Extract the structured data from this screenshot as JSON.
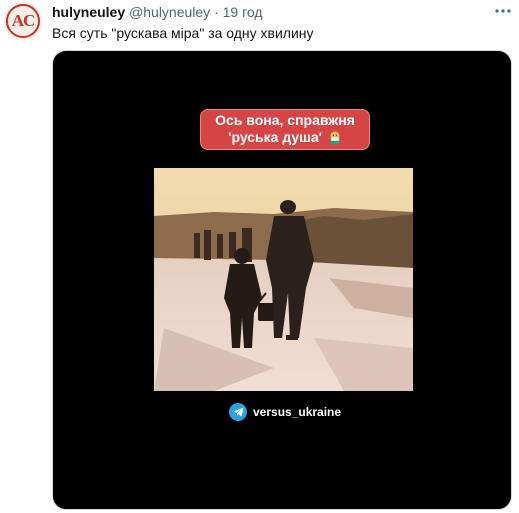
{
  "tweet": {
    "display_name": "hulyneuley",
    "handle": "@hulyneuley",
    "separator": "·",
    "time": "19 год",
    "text": "Вся суть \"рускава міра\" за одну хвилину",
    "more_icon": "more-horizontal-icon"
  },
  "avatar": {
    "label": "AC",
    "accent": "#c7342a"
  },
  "media": {
    "caption_line1": "Ось вона, справжня",
    "caption_line2": "'руська душа'",
    "caption_color": "#d64545",
    "caption_emoji": "face-with-mask-emoji",
    "watermark": "versus_ukraine",
    "watermark_icon": "telegram-icon"
  }
}
